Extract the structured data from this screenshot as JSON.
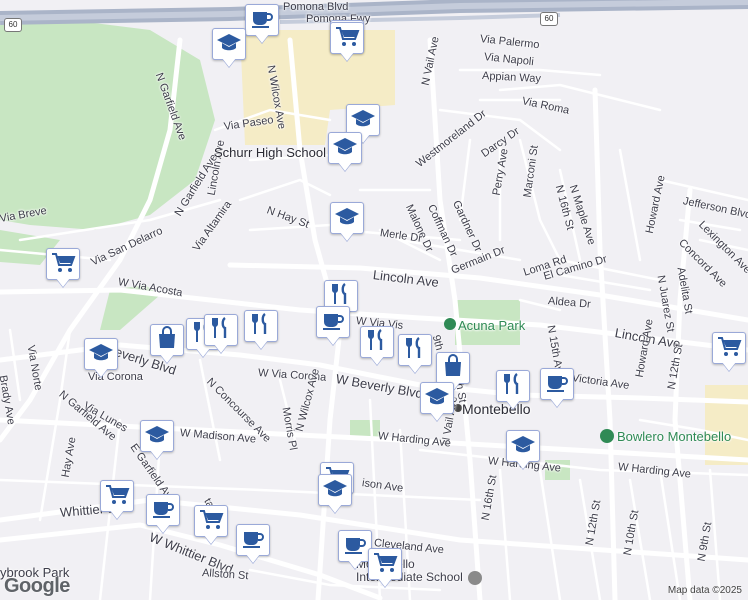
{
  "map": {
    "attribution": "Map data ©2025",
    "logo": "Google",
    "streets": [
      {
        "id": "pomona-blvd",
        "text": "Pomona Blvd"
      },
      {
        "id": "pomona-fwy",
        "text": "Pomona Fwy"
      },
      {
        "id": "via-palermo",
        "text": "Via Palermo"
      },
      {
        "id": "via-napoli",
        "text": "Via Napoli"
      },
      {
        "id": "appian-way",
        "text": "Appian Way"
      },
      {
        "id": "via-roma",
        "text": "Via Roma"
      },
      {
        "id": "n-vail-ave-top",
        "text": "N Vail Ave"
      },
      {
        "id": "n-wilcox-ave-top",
        "text": "N Wilcox Ave"
      },
      {
        "id": "n-garfield-ave-top",
        "text": "N Garfield Ave"
      },
      {
        "id": "via-paseo",
        "text": "Via Paseo"
      },
      {
        "id": "westmoreland",
        "text": "Westmoreland Dr"
      },
      {
        "id": "darcy",
        "text": "Darcy Dr"
      },
      {
        "id": "lincoln-ave-v",
        "text": "Lincoln Ave"
      },
      {
        "id": "n-hay-st",
        "text": "N Hay St"
      },
      {
        "id": "malone",
        "text": "Malone Dr"
      },
      {
        "id": "coffman",
        "text": "Coffman Dr"
      },
      {
        "id": "gardner",
        "text": "Gardner Dr"
      },
      {
        "id": "perry",
        "text": "Perry Ave"
      },
      {
        "id": "marconi",
        "text": "Marconi St"
      },
      {
        "id": "n-16th-top",
        "text": "N 16th St"
      },
      {
        "id": "n-maple",
        "text": "N Maple Ave"
      },
      {
        "id": "n-garfield-ave-2",
        "text": "N Garfield Ave"
      },
      {
        "id": "via-breve",
        "text": "Via Breve"
      },
      {
        "id": "via-san-delarro",
        "text": "Via San Delarro"
      },
      {
        "id": "via-altamira",
        "text": "Via Altamira"
      },
      {
        "id": "merle",
        "text": "Merle Dr"
      },
      {
        "id": "germain",
        "text": "Germain Dr"
      },
      {
        "id": "loma",
        "text": "Loma Rd"
      },
      {
        "id": "howard-top",
        "text": "Howard Ave"
      },
      {
        "id": "jefferson",
        "text": "Jefferson Blvd"
      },
      {
        "id": "lexington",
        "text": "Lexington Ave"
      },
      {
        "id": "concord",
        "text": "Concord Ave"
      },
      {
        "id": "n-juarez",
        "text": "N Juarez St"
      },
      {
        "id": "adelita",
        "text": "Adelita St"
      },
      {
        "id": "el-camino",
        "text": "El Camino Dr"
      },
      {
        "id": "lincoln-ave",
        "text": "Lincoln Ave"
      },
      {
        "id": "w-via-acosta",
        "text": "W Via Acosta"
      },
      {
        "id": "aldea",
        "text": "Aldea Dr"
      },
      {
        "id": "lincoln-ave-east",
        "text": "Lincoln Ave"
      },
      {
        "id": "via-norte",
        "text": "Via Norte"
      },
      {
        "id": "brady",
        "text": "Brady Ave"
      },
      {
        "id": "w-beverly-left",
        "text": "W Beverly Blvd"
      },
      {
        "id": "via-corona-left",
        "text": "Via Corona"
      },
      {
        "id": "n-concourse",
        "text": "N Concourse Ave"
      },
      {
        "id": "w-via-corona",
        "text": "W Via Corona"
      },
      {
        "id": "w-beverly",
        "text": "W Beverly Blvd"
      },
      {
        "id": "w-via-vis",
        "text": "W Via Vis"
      },
      {
        "id": "9th-st",
        "text": "9th St"
      },
      {
        "id": "n-15th-st",
        "text": "N 15th St"
      },
      {
        "id": "n-15th-ave",
        "text": "N 15th Ave"
      },
      {
        "id": "victoria",
        "text": "Victoria Ave"
      },
      {
        "id": "howard-mid",
        "text": "Howard Ave"
      },
      {
        "id": "n-12th",
        "text": "N 12th St"
      },
      {
        "id": "n-vail-mid",
        "text": "N Vail Ave"
      },
      {
        "id": "via-lunes",
        "text": "Via Lunes"
      },
      {
        "id": "n-garfield-low",
        "text": "N Garfield Ave"
      },
      {
        "id": "morris-pl",
        "text": "Morris Pl"
      },
      {
        "id": "n-wilcox-low",
        "text": "N Wilcox Ave"
      },
      {
        "id": "w-madison",
        "text": "W Madison Ave"
      },
      {
        "id": "w-harding",
        "text": "W Harding Ave"
      },
      {
        "id": "w-harding-2",
        "text": "W Harding Ave"
      },
      {
        "id": "w-harding-3",
        "text": "W Harding Ave"
      },
      {
        "id": "hay-ave",
        "text": "Hay Ave"
      },
      {
        "id": "w-ison",
        "text": "ison Ave"
      },
      {
        "id": "whittier-blvd",
        "text": "Whittier Blvd"
      },
      {
        "id": "w-whittier",
        "text": "W Whittier Blvd"
      },
      {
        "id": "n-16th-low",
        "text": "N 16th St"
      },
      {
        "id": "w-cleveland",
        "text": "Cleveland Ave"
      },
      {
        "id": "allston",
        "text": "Allston St"
      },
      {
        "id": "n-12th-low",
        "text": "N 12th St"
      },
      {
        "id": "n-10th",
        "text": "N 10th St"
      },
      {
        "id": "n-9th",
        "text": "N 9th St"
      },
      {
        "id": "ybrook",
        "text": "ybrook Park"
      },
      {
        "id": "ta",
        "text": "ta"
      },
      {
        "id": "e-garfield-low",
        "text": "E Garfield Ave"
      }
    ],
    "places": {
      "schurr": "Schurr High School",
      "acuna": "Acuna Park",
      "montebello": "Montebello",
      "bowlero": "Bowlero Montebello",
      "intermediate": "Montebello Intermediate School"
    },
    "colors": {
      "background": "#f1f0f4",
      "park": "#c8e6c2",
      "school_area": "#f5ecc6",
      "highway": "#aab4c8",
      "marker_border": "#9aa9d8",
      "marker_icon": "#2c5aa0",
      "poi_green": "#2f8a55"
    },
    "markers": [
      {
        "type": "cafe-icon"
      },
      {
        "type": "school-icon"
      },
      {
        "type": "shopping-cart-icon"
      },
      {
        "type": "school-icon"
      },
      {
        "type": "school-icon"
      },
      {
        "type": "school-icon"
      },
      {
        "type": "shopping-cart-icon"
      },
      {
        "type": "shopping-cart-icon"
      },
      {
        "type": "restaurant-icon"
      },
      {
        "type": "shopping-bag-icon"
      },
      {
        "type": "restaurant-icon"
      },
      {
        "type": "restaurant-icon"
      },
      {
        "type": "restaurant-icon"
      },
      {
        "type": "cafe-icon"
      },
      {
        "type": "restaurant-icon"
      },
      {
        "type": "restaurant-icon"
      },
      {
        "type": "shopping-bag-icon"
      },
      {
        "type": "school-icon"
      },
      {
        "type": "restaurant-icon"
      },
      {
        "type": "cafe-icon"
      },
      {
        "type": "shopping-cart-icon"
      },
      {
        "type": "school-icon"
      },
      {
        "type": "school-icon"
      },
      {
        "type": "school-icon"
      },
      {
        "type": "shopping-cart-icon"
      },
      {
        "type": "cafe-icon"
      },
      {
        "type": "shopping-cart-icon"
      },
      {
        "type": "cafe-icon"
      },
      {
        "type": "cafe-icon"
      },
      {
        "type": "shopping-cart-icon"
      },
      {
        "type": "school-icon"
      },
      {
        "type": "shopping-cart-icon"
      }
    ],
    "highway_shields": [
      "60",
      "60"
    ]
  }
}
